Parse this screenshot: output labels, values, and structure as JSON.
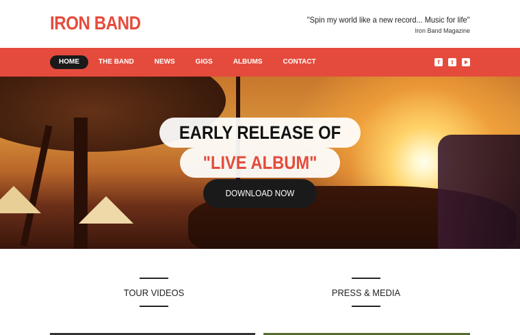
{
  "header": {
    "brand": "IRON BAND",
    "quote": "\"Spin my world like a new record... Music for life\"",
    "quote_source": "Iron Band Magazine"
  },
  "nav": {
    "items": [
      {
        "label": "HOME",
        "active": true
      },
      {
        "label": "THE BAND"
      },
      {
        "label": "NEWS"
      },
      {
        "label": "GIGS"
      },
      {
        "label": "ALBUMS"
      },
      {
        "label": "CONTACT"
      }
    ],
    "social": [
      {
        "icon": "facebook-icon",
        "glyph": "f"
      },
      {
        "icon": "tumblr-icon",
        "glyph": "t"
      },
      {
        "icon": "youtube-icon",
        "glyph": ""
      }
    ]
  },
  "hero": {
    "title": "EARLY RELEASE OF",
    "subtitle": "\"LIVE ALBUM\"",
    "button": "DOWNLOAD NOW"
  },
  "sections": [
    {
      "label": "TOUR VIDEOS"
    },
    {
      "label": "PRESS & MEDIA"
    }
  ],
  "colors": {
    "accent": "#e54b3c",
    "dark": "#1a1a1a"
  }
}
